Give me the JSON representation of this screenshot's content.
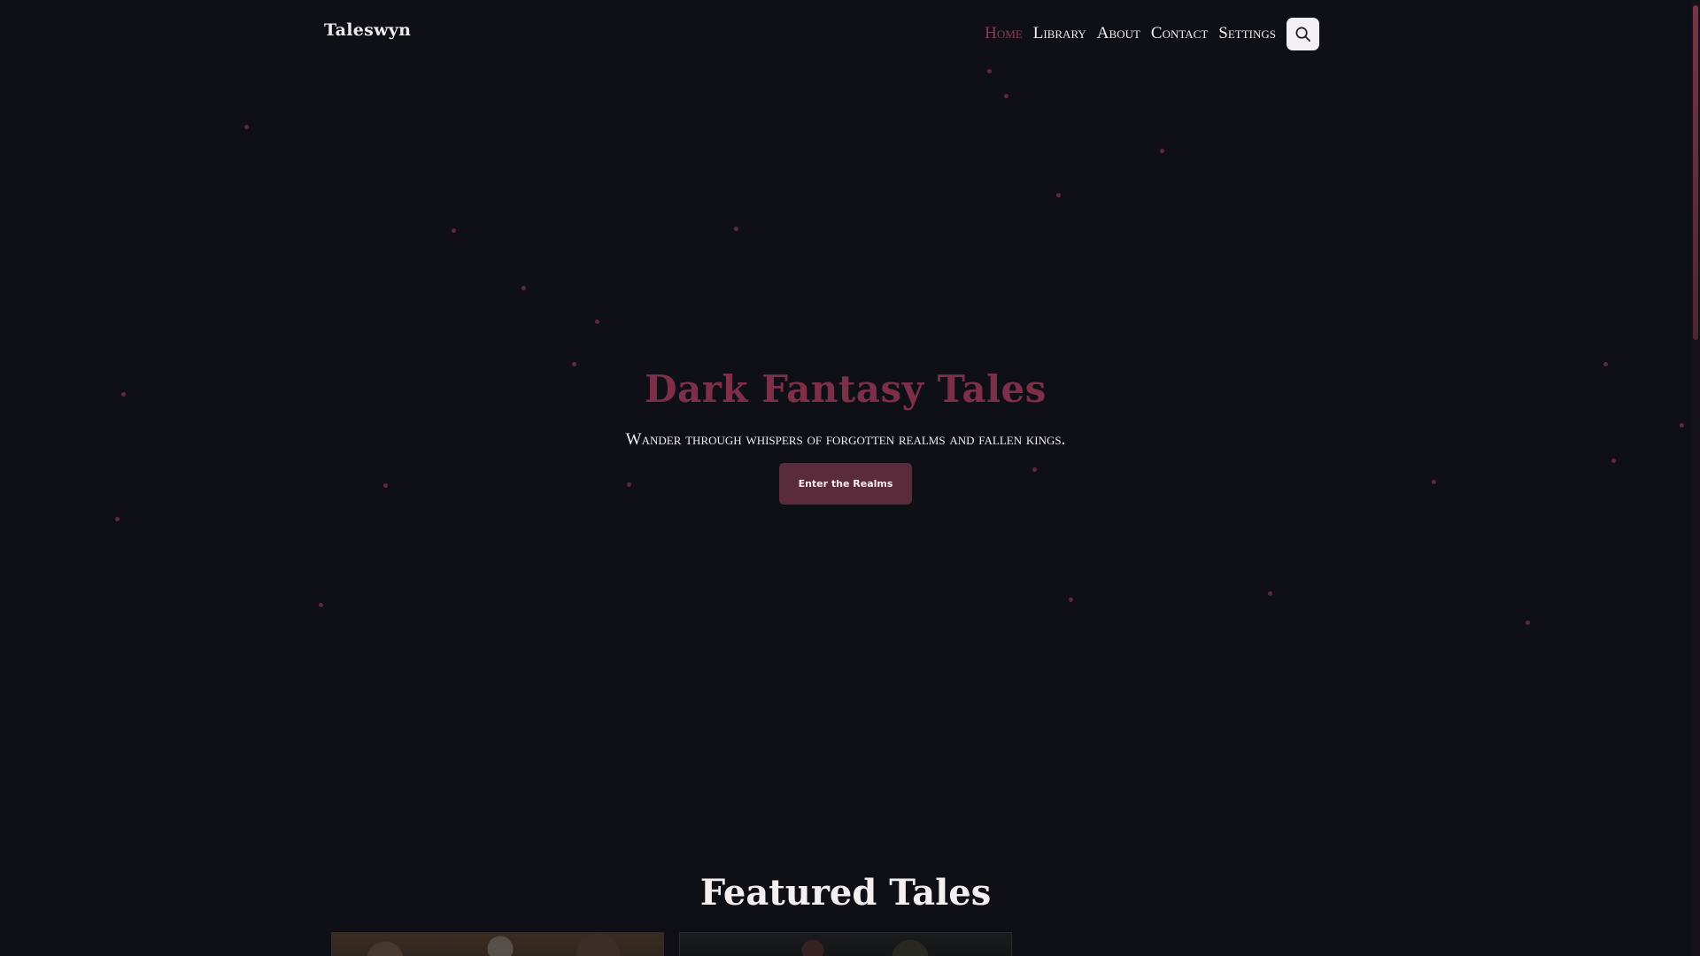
{
  "header": {
    "brand": "Taleswyn",
    "nav": [
      {
        "label": "Home",
        "active": true
      },
      {
        "label": "Library",
        "active": false
      },
      {
        "label": "About",
        "active": false
      },
      {
        "label": "Contact",
        "active": false
      },
      {
        "label": "Settings",
        "active": false
      }
    ],
    "search_icon": "search-icon"
  },
  "hero": {
    "title": "Dark Fantasy Tales",
    "subtitle": "Wander through whispers of forgotten realms and fallen kings.",
    "cta_label": "Enter the Realms"
  },
  "featured": {
    "title": "Featured Tales"
  },
  "colors": {
    "background": "#0f1016",
    "accent": "#7d2f47",
    "button": "#5a2b3a",
    "star": "#5c2a3a"
  }
}
